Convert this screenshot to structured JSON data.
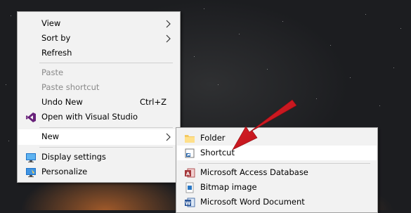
{
  "context_menu": {
    "items": [
      {
        "label": "View",
        "has_submenu": true
      },
      {
        "label": "Sort by",
        "has_submenu": true
      },
      {
        "label": "Refresh"
      },
      {
        "label": "Paste",
        "disabled": true
      },
      {
        "label": "Paste shortcut",
        "disabled": true
      },
      {
        "label": "Undo New",
        "shortcut": "Ctrl+Z"
      },
      {
        "label": "Open with Visual Studio",
        "icon": "visual-studio-icon"
      },
      {
        "label": "New",
        "has_submenu": true,
        "highlighted": true
      },
      {
        "label": "Display settings",
        "icon": "display-settings-icon"
      },
      {
        "label": "Personalize",
        "icon": "personalize-icon"
      }
    ]
  },
  "new_submenu": {
    "items": [
      {
        "label": "Folder",
        "icon": "folder-icon"
      },
      {
        "label": "Shortcut",
        "icon": "shortcut-icon",
        "highlighted": true
      },
      {
        "label": "Microsoft Access Database",
        "icon": "access-database-icon"
      },
      {
        "label": "Bitmap image",
        "icon": "bitmap-image-icon"
      },
      {
        "label": "Microsoft Word Document",
        "icon": "word-document-icon"
      }
    ]
  },
  "annotation": {
    "arrow_color": "#d0121b"
  },
  "colors": {
    "menu_bg": "#f2f2f2",
    "highlight": "#ffffff",
    "disabled_text": "#8a8a8a"
  }
}
